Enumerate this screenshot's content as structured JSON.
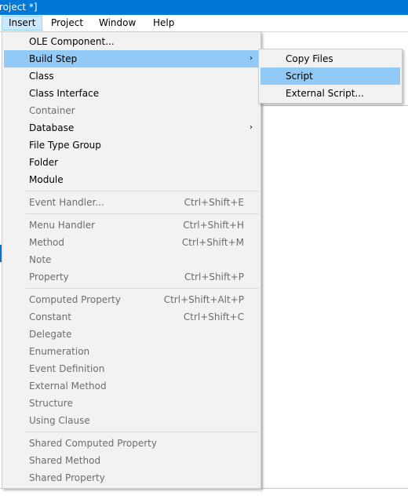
{
  "window": {
    "title": "roject *]"
  },
  "menubar": {
    "items": [
      {
        "label": "Insert"
      },
      {
        "label": "Project"
      },
      {
        "label": "Window"
      },
      {
        "label": "Help"
      }
    ]
  },
  "insert_menu": {
    "items": [
      {
        "label": "OLE Component...",
        "shortcut": ""
      },
      {
        "label": "Build Step",
        "shortcut": ""
      },
      {
        "label": "Class",
        "shortcut": ""
      },
      {
        "label": "Class Interface",
        "shortcut": ""
      },
      {
        "label": "Container",
        "shortcut": ""
      },
      {
        "label": "Database",
        "shortcut": ""
      },
      {
        "label": "File Type Group",
        "shortcut": ""
      },
      {
        "label": "Folder",
        "shortcut": ""
      },
      {
        "label": "Module",
        "shortcut": ""
      },
      {
        "label": "Event Handler...",
        "shortcut": "Ctrl+Shift+E"
      },
      {
        "label": "Menu Handler",
        "shortcut": "Ctrl+Shift+H"
      },
      {
        "label": "Method",
        "shortcut": "Ctrl+Shift+M"
      },
      {
        "label": "Note",
        "shortcut": ""
      },
      {
        "label": "Property",
        "shortcut": "Ctrl+Shift+P"
      },
      {
        "label": "Computed Property",
        "shortcut": "Ctrl+Shift+Alt+P"
      },
      {
        "label": "Constant",
        "shortcut": "Ctrl+Shift+C"
      },
      {
        "label": "Delegate",
        "shortcut": ""
      },
      {
        "label": "Enumeration",
        "shortcut": ""
      },
      {
        "label": "Event Definition",
        "shortcut": ""
      },
      {
        "label": "External Method",
        "shortcut": ""
      },
      {
        "label": "Structure",
        "shortcut": ""
      },
      {
        "label": "Using Clause",
        "shortcut": ""
      },
      {
        "label": "Shared Computed Property",
        "shortcut": ""
      },
      {
        "label": "Shared Method",
        "shortcut": ""
      },
      {
        "label": "Shared Property",
        "shortcut": ""
      }
    ]
  },
  "build_step_submenu": {
    "items": [
      {
        "label": "Copy Files"
      },
      {
        "label": "Script"
      },
      {
        "label": "External Script..."
      }
    ]
  },
  "icons": {
    "submenu_arrow": "chevron-right-icon",
    "glyph": "›"
  },
  "colors": {
    "titlebar": "#0078d7",
    "menu_background": "#f2f2f2",
    "highlight": "#91c9f7",
    "disabled_text": "#6d6d6d"
  }
}
